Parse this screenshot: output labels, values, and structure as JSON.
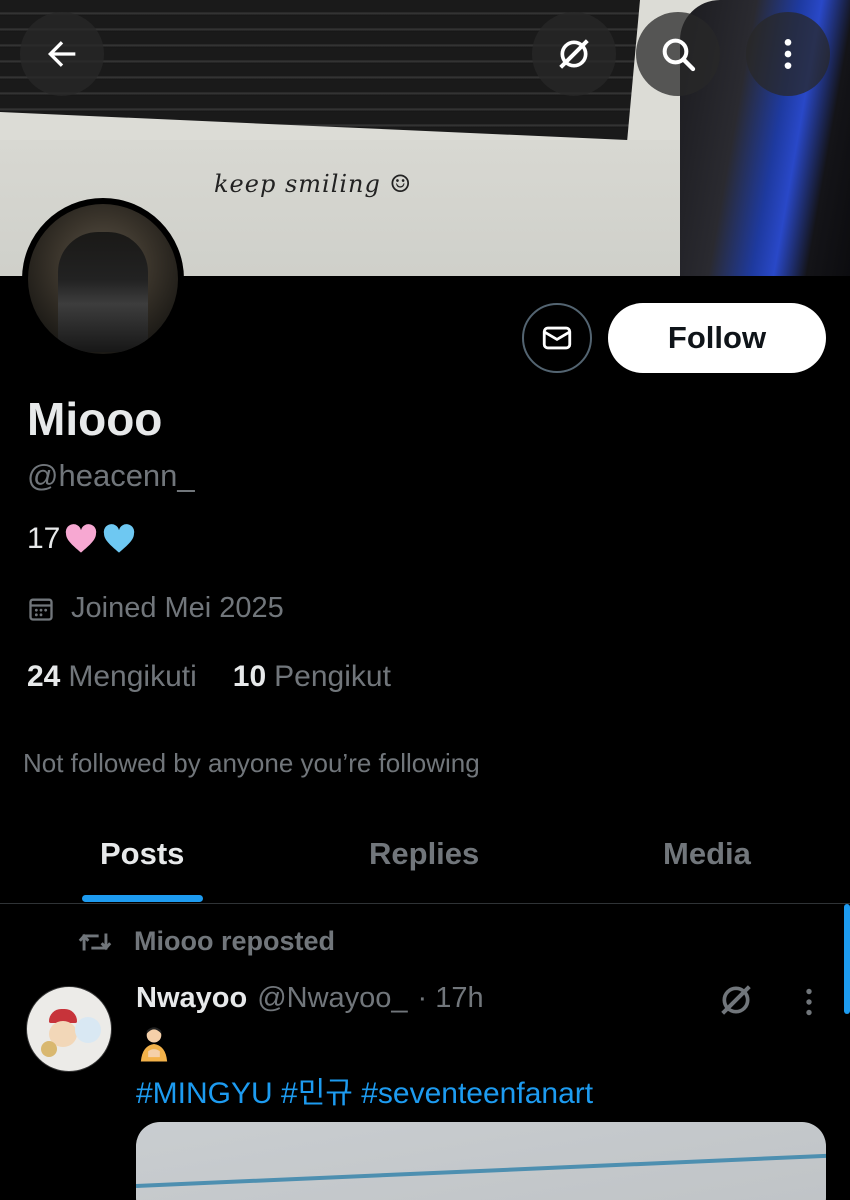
{
  "banner": {
    "text": "keep smiling ☺"
  },
  "topbar": {
    "back_icon": "arrow-left-icon",
    "grok_icon": "grok-icon",
    "search_icon": "search-icon",
    "more_icon": "more-vertical-icon"
  },
  "profile": {
    "name": "Miooo",
    "handle": "@heacenn_",
    "bio_text": "17",
    "bio_emojis": [
      "pink-heart",
      "light-blue-heart"
    ],
    "joined": "Joined Mei 2025",
    "following_count": "24",
    "following_label": "Mengikuti",
    "followers_count": "10",
    "followers_label": "Pengikut",
    "not_followed": "Not followed by anyone you’re following"
  },
  "actions": {
    "follow_label": "Follow",
    "message_icon": "mail-icon"
  },
  "tabs": [
    {
      "label": "Posts",
      "active": true
    },
    {
      "label": "Replies",
      "active": false
    },
    {
      "label": "Media",
      "active": false
    }
  ],
  "post": {
    "repost_label": "Miooo reposted",
    "author": "Nwayoo",
    "handle": "@Nwayoo_",
    "time": "· 17h",
    "tags": "#MINGYU #민규 #seventeenfanart"
  },
  "colors": {
    "accent": "#1d9bf0",
    "background": "#000000",
    "muted": "#71767b",
    "text": "#e7e9ea"
  }
}
